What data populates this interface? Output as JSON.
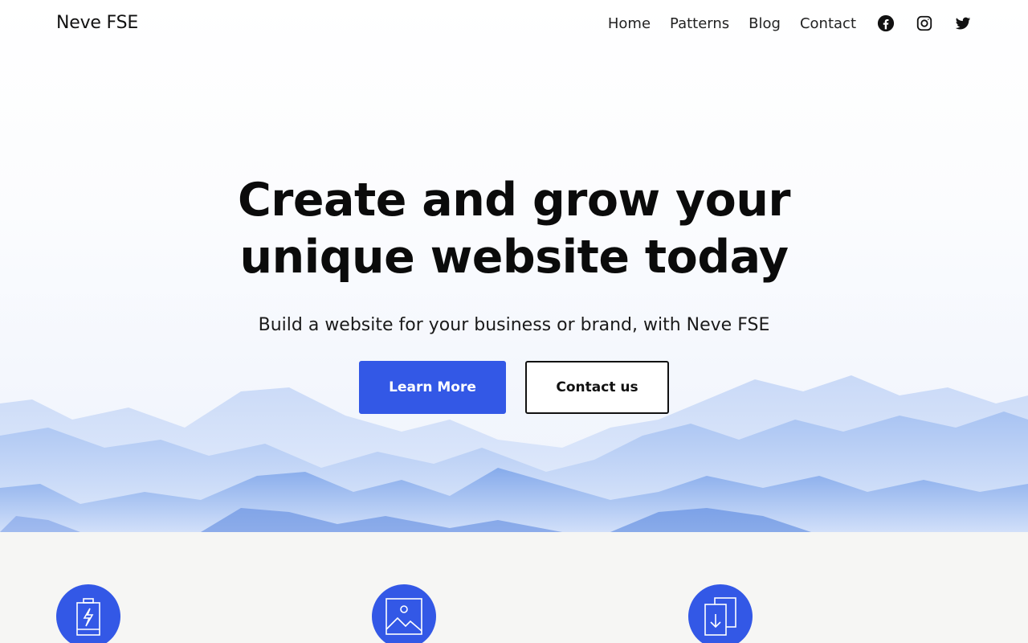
{
  "site": {
    "title": "Neve FSE"
  },
  "nav": {
    "items": [
      {
        "label": "Home"
      },
      {
        "label": "Patterns"
      },
      {
        "label": "Blog"
      },
      {
        "label": "Contact"
      }
    ],
    "social": [
      "facebook-icon",
      "instagram-icon",
      "twitter-icon"
    ]
  },
  "hero": {
    "title_line1": "Create and grow your",
    "title_line2": "unique website today",
    "subtitle": "Build a website for your business or brand, with Neve FSE",
    "primary_button": "Learn More",
    "secondary_button": "Contact us"
  },
  "features": {
    "icons": [
      "battery-bolt-icon",
      "image-icon",
      "document-download-icon"
    ]
  },
  "colors": {
    "accent": "#3358e6",
    "text": "#111111",
    "features_bg": "#f6f6f4"
  }
}
